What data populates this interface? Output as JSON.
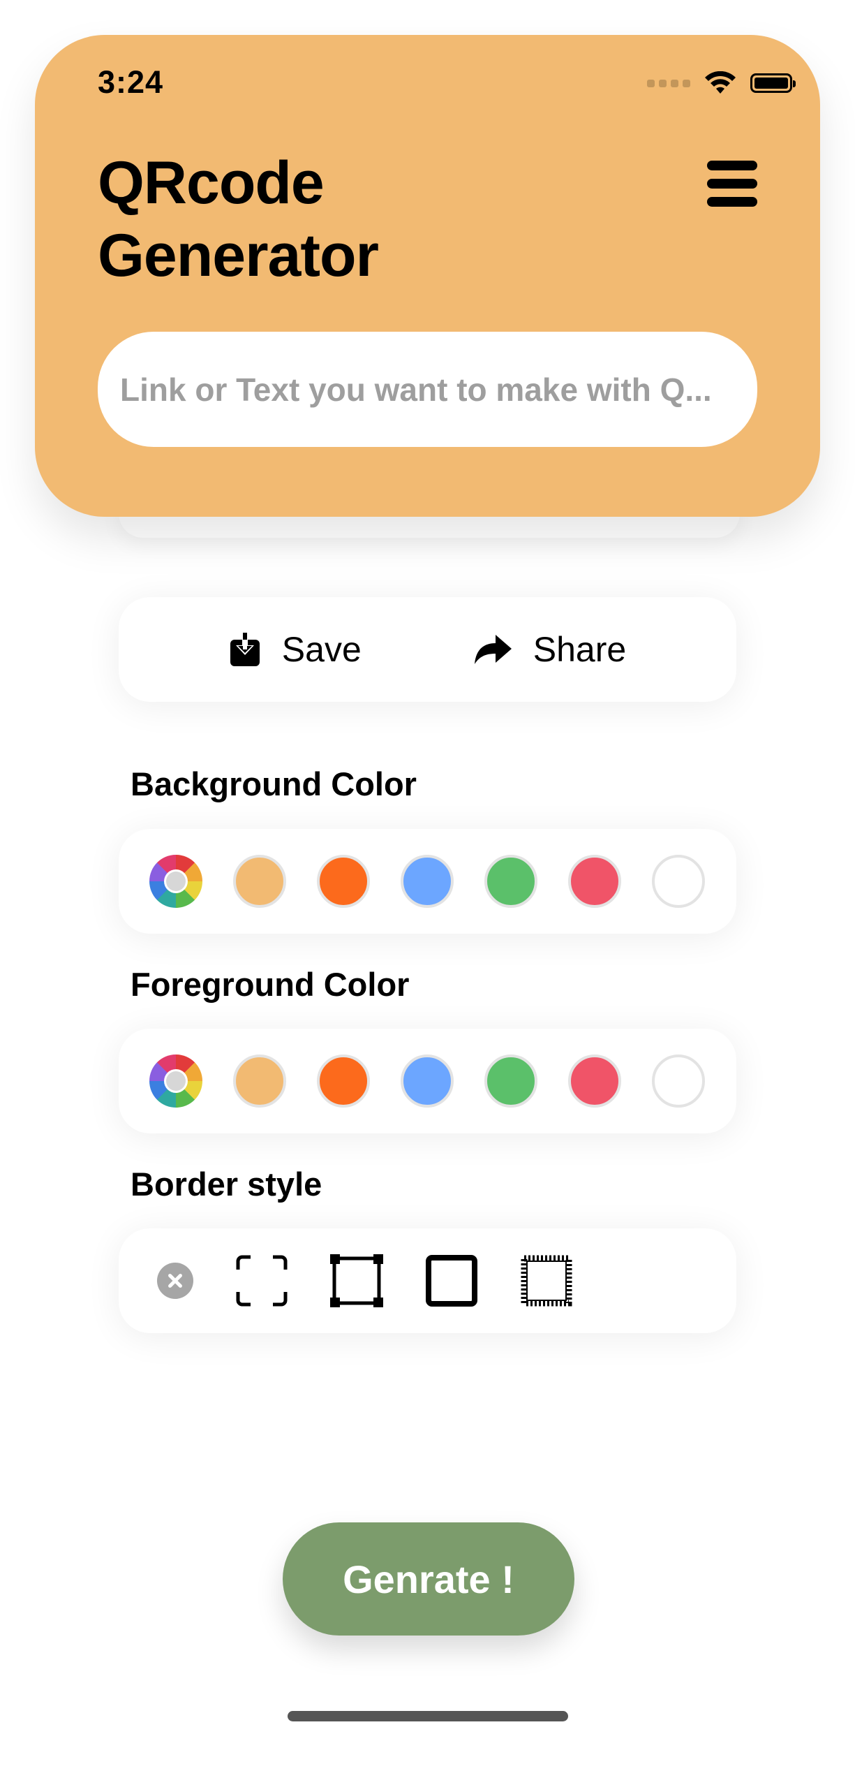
{
  "status_bar": {
    "time": "3:24"
  },
  "header": {
    "title_line1": "QRcode",
    "title_line2": "Generator",
    "input_placeholder": "Link or Text you want to make with Q...",
    "input_value": "",
    "accent_color": "#F2BA72"
  },
  "actions": {
    "save_label": "Save",
    "share_label": "Share"
  },
  "background_color": {
    "label": "Background Color",
    "swatches": [
      "color-picker",
      "#F2BA72",
      "#FC6A1C",
      "#6CA6FF",
      "#5BC06A",
      "#F05468",
      "#FFFFFF"
    ]
  },
  "foreground_color": {
    "label": "Foreground Color",
    "swatches": [
      "color-picker",
      "#F2BA72",
      "#FC6A1C",
      "#6CA6FF",
      "#5BC06A",
      "#F05468",
      "#FFFFFF"
    ]
  },
  "border_style": {
    "label": "Border style",
    "options": [
      "none",
      "corners",
      "square-corner-nubs",
      "solid-square",
      "stamp-square"
    ]
  },
  "generate_button": {
    "label": "Genrate !",
    "color": "#7C9C6C"
  }
}
